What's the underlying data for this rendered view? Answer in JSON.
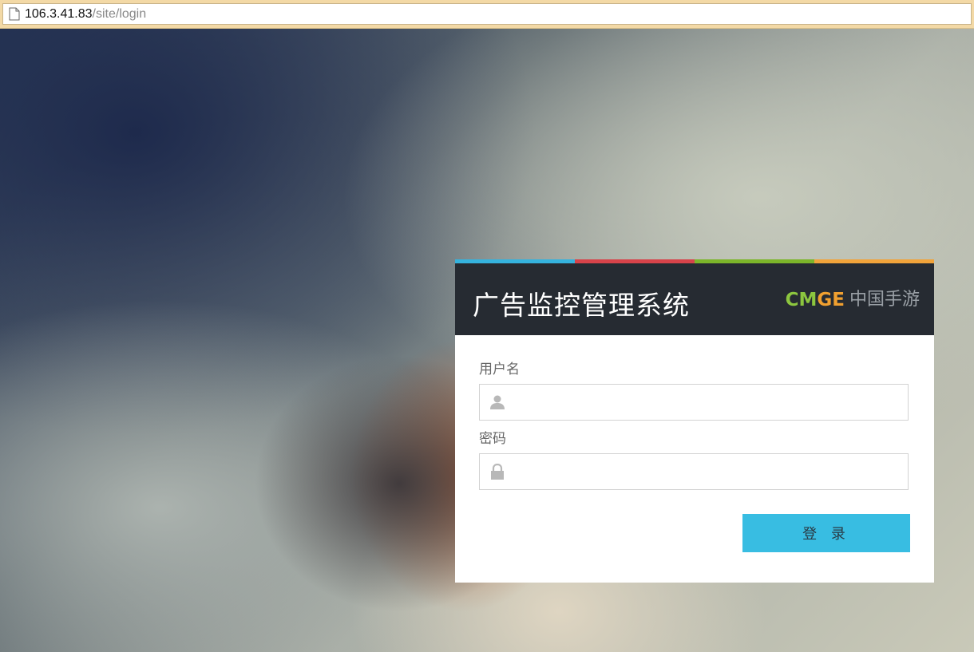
{
  "browser": {
    "url_host": "106.3.41.83",
    "url_path": "/site/login"
  },
  "login": {
    "stripe_colors": [
      "#35b3de",
      "#d7434a",
      "#7cb52a",
      "#f1a33a"
    ],
    "title": "广告监控管理系统",
    "brand_en": "CMGE",
    "brand_cn": "中国手游",
    "username_label": "用户名",
    "username_value": "",
    "password_label": "密码",
    "password_value": "",
    "submit_label": "登 录"
  },
  "icons": {
    "page": "page-icon",
    "user": "user-icon",
    "lock": "lock-icon"
  }
}
